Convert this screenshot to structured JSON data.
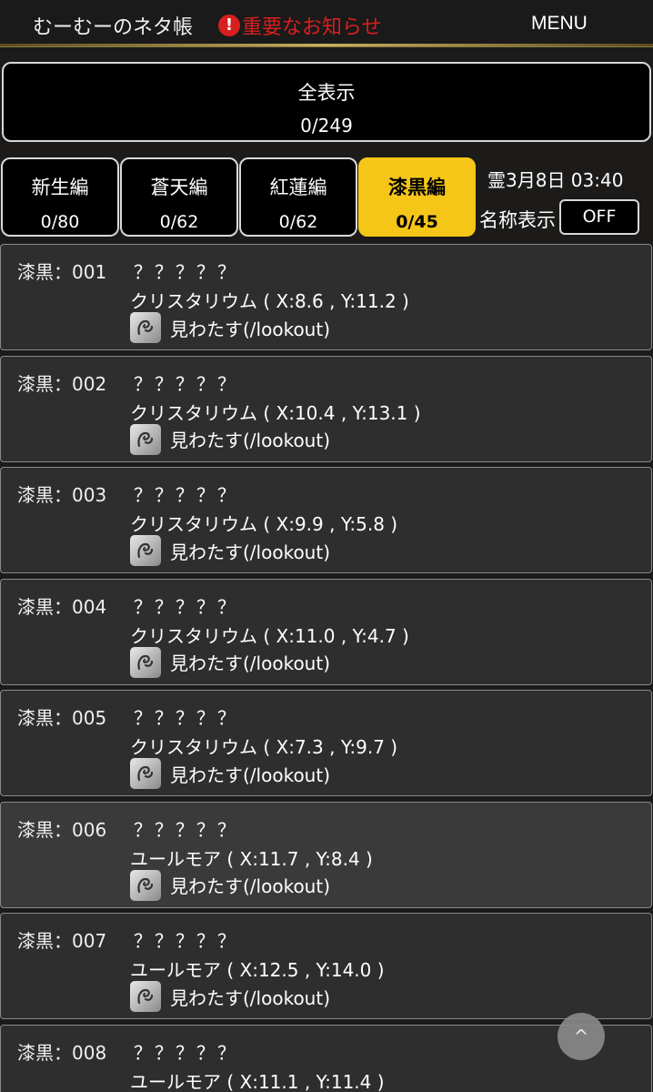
{
  "header": {
    "title": "むーむーのネタ帳",
    "notice_icon": "!",
    "notice": "重要なお知らせ",
    "menu": "MENU"
  },
  "all": {
    "label": "全表示",
    "count": "0/249"
  },
  "tabs": [
    {
      "label": "新生編",
      "count": "0/80"
    },
    {
      "label": "蒼天編",
      "count": "0/62"
    },
    {
      "label": "紅蓮編",
      "count": "0/62"
    },
    {
      "label": "漆黒編",
      "count": "0/45"
    }
  ],
  "active_tab_color": "#f5c518",
  "datetime": "霊3月8日 03:40",
  "name_display": {
    "label": "名称表示",
    "value": "OFF"
  },
  "items": [
    {
      "code": "漆黒：001",
      "name": "？？？？？",
      "location": "クリスタリウム ( X:8.6 , Y:11.2 )",
      "emote": "見わたす(/lookout)"
    },
    {
      "code": "漆黒：002",
      "name": "？？？？？",
      "location": "クリスタリウム ( X:10.4 , Y:13.1 )",
      "emote": "見わたす(/lookout)"
    },
    {
      "code": "漆黒：003",
      "name": "？？？？？",
      "location": "クリスタリウム ( X:9.9 , Y:5.8 )",
      "emote": "見わたす(/lookout)"
    },
    {
      "code": "漆黒：004",
      "name": "？？？？？",
      "location": "クリスタリウム ( X:11.0 , Y:4.7 )",
      "emote": "見わたす(/lookout)"
    },
    {
      "code": "漆黒：005",
      "name": "？？？？？",
      "location": "クリスタリウム ( X:7.3 , Y:9.7 )",
      "emote": "見わたす(/lookout)"
    },
    {
      "code": "漆黒：006",
      "name": "？？？？？",
      "location": "ユールモア ( X:11.7 , Y:8.4 )",
      "emote": "見わたす(/lookout)"
    },
    {
      "code": "漆黒：007",
      "name": "？？？？？",
      "location": "ユールモア ( X:12.5 , Y:14.0 )",
      "emote": "見わたす(/lookout)"
    },
    {
      "code": "漆黒：008",
      "name": "？？？？？",
      "location": "ユールモア ( X:11.1 , Y:11.4 )",
      "emote": ""
    }
  ],
  "scroll_top": "^"
}
